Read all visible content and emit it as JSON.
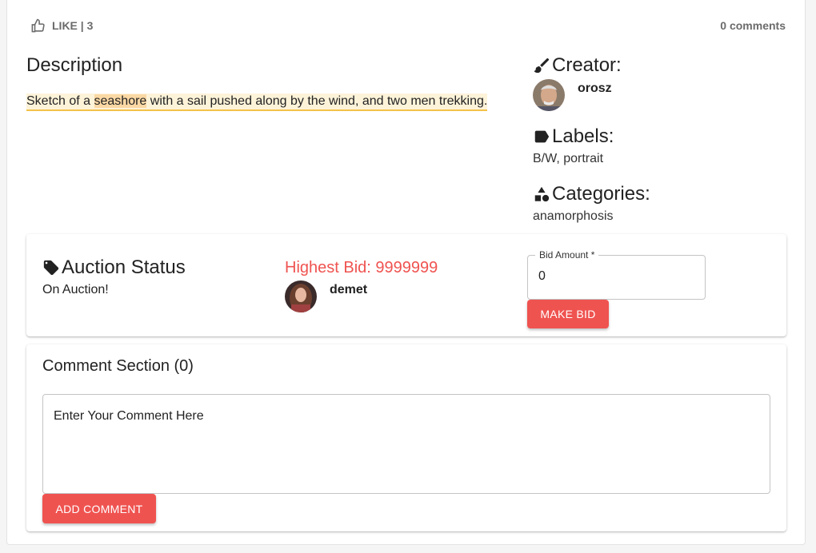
{
  "header": {
    "like_label": "LIKE | 3",
    "comments_count": "0 comments"
  },
  "description": {
    "title": "Description",
    "text_before": "Sketch of a ",
    "text_highlight": "seashore",
    "text_after": " with a sail pushed along by the wind, and two men trekking."
  },
  "creator": {
    "title": "Creator:",
    "name": "orosz"
  },
  "labels": {
    "title": "Labels:",
    "value": "B/W, portrait"
  },
  "categories": {
    "title": "Categories:",
    "value": "anamorphosis"
  },
  "auction": {
    "title": "Auction Status",
    "status": "On Auction!",
    "highest_bid": "Highest Bid: 9999999",
    "bidder_name": "demet",
    "bid_label": "Bid Amount *",
    "bid_value": "0",
    "make_bid_label": "MAKE BID"
  },
  "comments": {
    "title": "Comment Section (0)",
    "placeholder": "Enter Your Comment Here",
    "add_label": "ADD COMMENT"
  },
  "colors": {
    "accent": "#ef5350",
    "highlight": "#fdf3d9",
    "highlight_strong": "#fbd8a4"
  },
  "icons": {
    "like": "thumbs-up-icon",
    "creator": "brush-icon",
    "labels": "label-icon",
    "categories": "shapes-icon",
    "auction": "tag-icon"
  }
}
